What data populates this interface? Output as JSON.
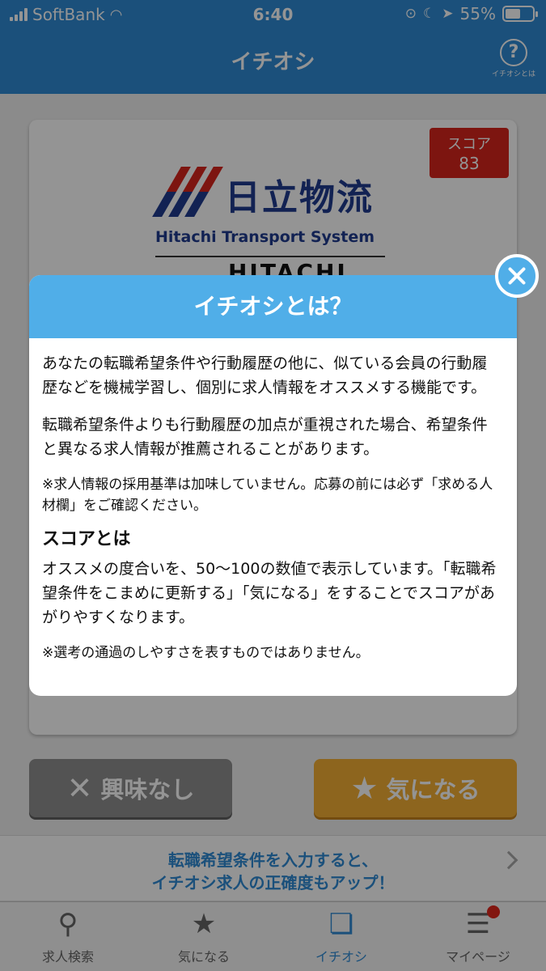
{
  "status_bar": {
    "carrier": "SoftBank",
    "time": "6:40",
    "battery": "55%",
    "battery_level": 0.55
  },
  "header": {
    "title": "イチオシ",
    "help_label": "イチオシとは"
  },
  "job_card": {
    "score_label": "スコア",
    "score_value": "83",
    "company_name_jp": "日立物流",
    "company_name_en": "Hitachi Transport System",
    "brand_text": "HITACHI"
  },
  "actions": {
    "not_interested_label": "興味なし",
    "interested_label": "気になる"
  },
  "promo": {
    "line1": "転職希望条件を入力すると、",
    "line2": "イチオシ求人の正確度もアップ！"
  },
  "tabs": [
    {
      "label": "求人検索",
      "icon": "search-icon"
    },
    {
      "label": "気になる",
      "icon": "star-icon"
    },
    {
      "label": "イチオシ",
      "icon": "cards-icon",
      "active": true
    },
    {
      "label": "マイページ",
      "icon": "profile-icon",
      "badge": true
    }
  ],
  "modal": {
    "title": "イチオシとは？",
    "paragraph1": "あなたの転職希望条件や行動履歴の他に、似ている会員の行動履歴などを機械学習し、個別に求人情報をオススメする機能です。",
    "paragraph2": "転職希望条件よりも行動履歴の加点が重視された場合、希望条件と異なる求人情報が推薦されることがあります。",
    "note1": "※求人情報の採用基準は加味していません。応募の前には必ず「求める人材欄」をご確認ください。",
    "score_heading": "スコアとは",
    "paragraph3": "オススメの度合いを、50〜100の数値で表示しています。「転職希望条件をこまめに更新する」「気になる」をすることでスコアがあがりやすくなります。",
    "note2": "※選考の通過のしやすさを表すものではありません。"
  },
  "colors": {
    "header_blue": "#2f8bd5",
    "modal_header": "#50aee8",
    "score_red": "#d7251d",
    "like_orange": "#f3ae35",
    "dislike_gray": "#8f8f8f",
    "badge_red": "#e0261c"
  }
}
